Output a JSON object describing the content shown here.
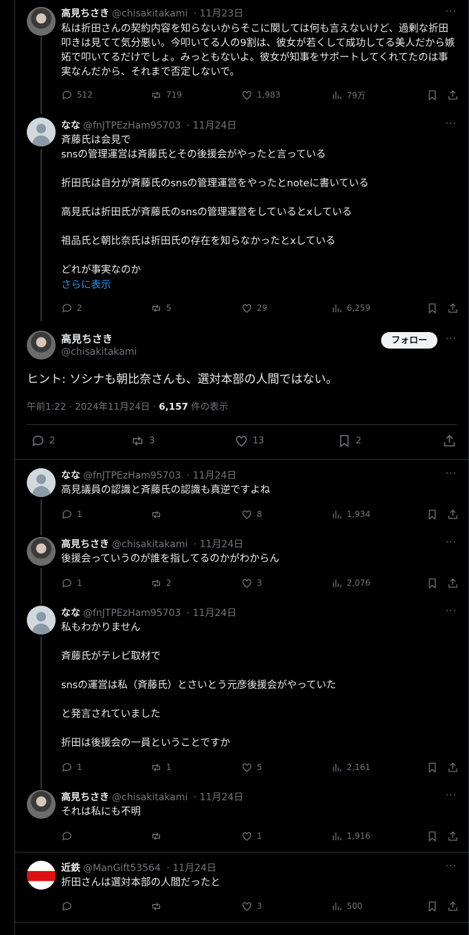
{
  "tweets": [
    {
      "name": "高見ちさき",
      "handle": "@chisakitakami",
      "date": "11月23日",
      "text": "私は折田さんの契約内容を知らないからそこに関しては何も言えないけど、過剰な折田叩きは見てて気分悪い。今叩いてる人の9割は、彼女が若くして成功してる美人だから嫉妬で叩いてるだけでしょ。みっともないよ。彼女が知事をサポートしてくれてたのは事実なんだから、それまで否定しないで。",
      "replies": "512",
      "reposts": "719",
      "likes": "1,983",
      "views": "79万"
    },
    {
      "name": "なな",
      "handle": "@fnJTPEzHam95703",
      "date": "11月24日",
      "text": "斉藤氏は会見で\nsnsの管理運営は斉藤氏とその後援会がやったと言っている\n\n折田氏は自分が斉藤氏のsnsの管理運営をやったとnoteに書いている\n\n高見氏は折田氏が斉藤氏のsnsの管理運営をしているとxしている\n\n祖品氏と朝比奈氏は折田氏の存在を知らなかったとxしている\n\nどれが事実なのか",
      "show_more": "さらに表示",
      "replies": "2",
      "reposts": "5",
      "likes": "29",
      "views": "6,259"
    },
    {
      "name": "なな",
      "handle": "@fnJTPEzHam95703",
      "date": "11月24日",
      "text": "高見議員の認識と斉藤氏の認識も真逆ですよね",
      "replies": "1",
      "reposts": "",
      "likes": "8",
      "views": "1,934"
    },
    {
      "name": "高見ちさき",
      "handle": "@chisakitakami",
      "date": "11月24日",
      "text": "後援会っていうのが誰を指してるのかがわからん",
      "replies": "1",
      "reposts": "2",
      "likes": "3",
      "views": "2,076"
    },
    {
      "name": "なな",
      "handle": "@fnJTPEzHam95703",
      "date": "11月24日",
      "text": "私もわかりません\n\n斉藤氏がテレビ取材で\n\nsnsの運営は私（斉藤氏）とさいとう元彦後援会がやっていた\n\nと発言されていました\n\n折田は後援会の一員ということですか",
      "replies": "1",
      "reposts": "1",
      "likes": "5",
      "views": "2,161"
    },
    {
      "name": "高見ちさき",
      "handle": "@chisakitakami",
      "date": "11月24日",
      "text": "それは私にも不明",
      "replies": "",
      "reposts": "",
      "likes": "1",
      "views": "1,916"
    },
    {
      "name": "近鉄",
      "handle": "@ManGift53564",
      "date": "11月24日",
      "text": "折田さんは選対本部の人間だったと",
      "replies": "",
      "reposts": "",
      "likes": "3",
      "views": "500"
    }
  ],
  "main": {
    "name": "高見ちさき",
    "handle": "@chisakitakami",
    "follow": "フォロー",
    "text": "ヒント: ソシナも朝比奈さんも、選対本部の人間ではない。",
    "time": "午前1:22 · 2024年11月24日 · ",
    "views": "6,157",
    "views_label": " 件の表示",
    "replies": "2",
    "reposts": "3",
    "likes": "13",
    "bookmarks": "2"
  },
  "dot": " · ",
  "more_glyph": "···",
  "icons": {
    "reply": "reply-icon",
    "repost": "repost-icon",
    "like": "like-icon",
    "views": "views-icon",
    "bookmark": "bookmark-icon",
    "share": "share-icon"
  }
}
